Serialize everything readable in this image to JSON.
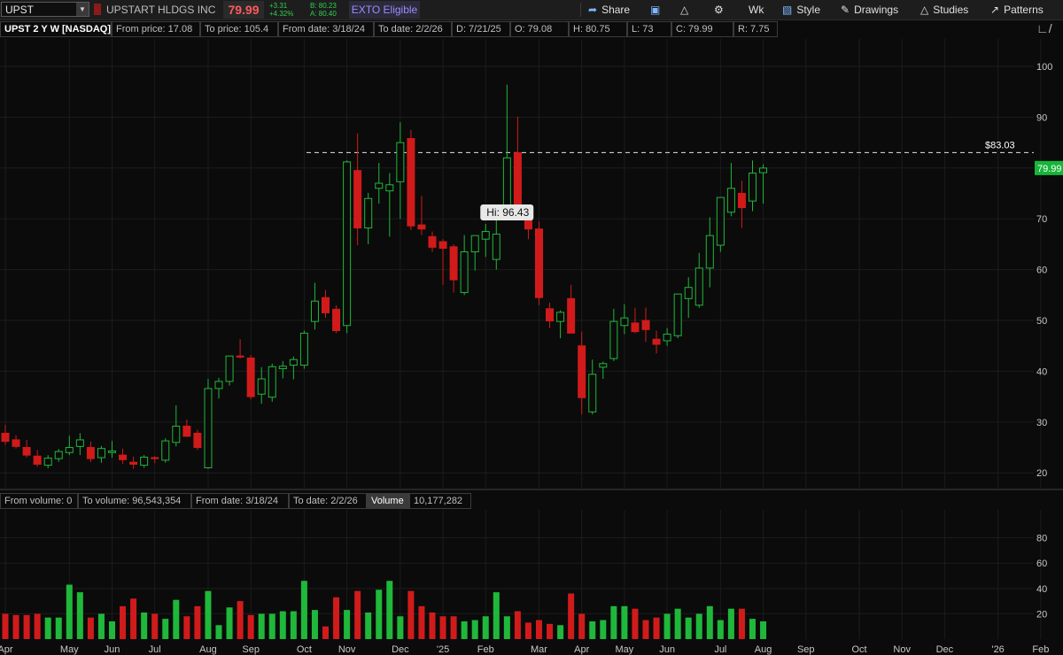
{
  "header": {
    "symbol": "UPST",
    "company": "UPSTART HLDGS INC",
    "last_price": "79.99",
    "net_change": "+3.31",
    "pct_change": "+4.32%",
    "bid": "B: 80.23",
    "ask": "A: 80.40",
    "exto": "EXTO Eligible",
    "toolbar": {
      "share": "Share",
      "aggregation": "Wk",
      "style": "Style",
      "drawings": "Drawings",
      "studies": "Studies",
      "patterns": "Patterns"
    }
  },
  "info_bar": [
    {
      "label": "UPST 2 Y W [NASDAQ]"
    },
    {
      "label": "From price: 17.08"
    },
    {
      "label": "To price: 105.4"
    },
    {
      "label": "From date: 3/18/24"
    },
    {
      "label": "To date: 2/2/26"
    },
    {
      "label": "D: 7/21/25"
    },
    {
      "label": "O: 79.08"
    },
    {
      "label": "H: 80.75"
    },
    {
      "label": "L: 73"
    },
    {
      "label": "C: 79.99"
    },
    {
      "label": "R: 7.75"
    }
  ],
  "volume_info_bar": [
    {
      "label": "From volume: 0"
    },
    {
      "label": "To volume: 96,543,354"
    },
    {
      "label": "From date: 3/18/24"
    },
    {
      "label": "To date: 2/2/26"
    },
    {
      "label": "Volume"
    },
    {
      "label": "10,177,282"
    }
  ],
  "colors": {
    "up": "#1fb83a",
    "down": "#d11b1b",
    "grid": "#1c1c1c",
    "axis_text": "#c8c8c8",
    "last_tag": "#17b53a"
  },
  "chart_data": [
    {
      "type": "candlestick",
      "title": "UPST 2 Y W [NASDAQ]",
      "ylim": [
        17.08,
        105.4
      ],
      "y_ticks": [
        20,
        30,
        40,
        50,
        60,
        70,
        80,
        90,
        100
      ],
      "x_ticks": [
        "Apr",
        "May",
        "Jun",
        "Jul",
        "Aug",
        "Sep",
        "Oct",
        "Nov",
        "Dec",
        "'25",
        "Feb",
        "Mar",
        "Apr",
        "May",
        "Jun",
        "Jul",
        "Aug",
        "Sep",
        "Oct",
        "Nov",
        "Dec",
        "'26",
        "Feb"
      ],
      "x_tick_index": [
        0,
        6,
        10,
        14,
        19,
        23,
        28,
        32,
        37,
        41,
        45,
        50,
        54,
        58,
        62,
        67,
        71,
        75,
        80,
        84,
        88,
        93,
        97
      ],
      "reference_line": {
        "value": 83.03,
        "label": "$83.03"
      },
      "high_label": "Hi: 96.43",
      "high_index": 45,
      "last_price_label": "79.99",
      "candles": [
        [
          27.8,
          29.5,
          25.5,
          26.2
        ],
        [
          26.5,
          27.4,
          24.8,
          25.2
        ],
        [
          25.0,
          26.5,
          23.0,
          23.5
        ],
        [
          23.3,
          24.5,
          21.2,
          21.7
        ],
        [
          21.5,
          23.5,
          20.9,
          22.9
        ],
        [
          22.8,
          24.7,
          22.2,
          24.2
        ],
        [
          24.0,
          27.3,
          23.5,
          25.0
        ],
        [
          25.2,
          27.8,
          23.5,
          26.5
        ],
        [
          25.0,
          26.2,
          22.1,
          22.8
        ],
        [
          23.0,
          25.3,
          22.0,
          24.8
        ],
        [
          24.0,
          26.3,
          23.0,
          24.3
        ],
        [
          23.5,
          24.8,
          21.8,
          22.6
        ],
        [
          22.1,
          23.2,
          20.8,
          21.7
        ],
        [
          21.5,
          23.5,
          21.0,
          23.1
        ],
        [
          23.0,
          23.3,
          21.9,
          22.8
        ],
        [
          22.5,
          26.8,
          22.0,
          26.3
        ],
        [
          26.0,
          33.3,
          25.2,
          29.2
        ],
        [
          29.2,
          30.5,
          27.8,
          27.2
        ],
        [
          27.8,
          28.5,
          24.5,
          25.0
        ],
        [
          21.0,
          38.5,
          20.8,
          36.6
        ],
        [
          36.6,
          38.7,
          34.6,
          38.0
        ],
        [
          38.0,
          42.8,
          37.2,
          43.0
        ],
        [
          43.0,
          46.3,
          42.5,
          42.8
        ],
        [
          42.6,
          43.2,
          34.5,
          35.0
        ],
        [
          35.5,
          40.8,
          33.6,
          38.5
        ],
        [
          34.9,
          41.5,
          34.0,
          40.9
        ],
        [
          40.5,
          42.0,
          38.6,
          41.0
        ],
        [
          41.2,
          42.9,
          38.4,
          42.3
        ],
        [
          41.2,
          48.0,
          40.5,
          47.5
        ],
        [
          49.8,
          57.4,
          48.2,
          53.8
        ],
        [
          54.5,
          56.0,
          50.5,
          51.5
        ],
        [
          52.2,
          53.0,
          47.5,
          48.0
        ],
        [
          49.0,
          81.5,
          47.5,
          81.2
        ],
        [
          79.5,
          86.8,
          64.8,
          68.2
        ],
        [
          68.2,
          75.1,
          65.0,
          74.0
        ],
        [
          76.0,
          81.0,
          73.0,
          77.0
        ],
        [
          75.5,
          79.0,
          66.5,
          76.7
        ],
        [
          77.3,
          89.0,
          70.0,
          85.0
        ],
        [
          85.8,
          87.5,
          67.8,
          68.6
        ],
        [
          68.8,
          74.5,
          66.8,
          68.0
        ],
        [
          66.5,
          67.5,
          63.5,
          64.4
        ],
        [
          65.5,
          66.0,
          57.0,
          64.2
        ],
        [
          64.5,
          65.0,
          55.5,
          58.0
        ],
        [
          55.5,
          66.8,
          55.0,
          63.5
        ],
        [
          63.5,
          66.5,
          59.8,
          66.7
        ],
        [
          66.0,
          69.0,
          62.5,
          67.5
        ],
        [
          62.0,
          71.0,
          60.0,
          67.0
        ],
        [
          71.0,
          96.4,
          70.5,
          82.0
        ],
        [
          83.0,
          90.1,
          70.0,
          71.5
        ],
        [
          71.2,
          72.6,
          66.0,
          68.0
        ],
        [
          68.0,
          69.5,
          53.0,
          54.5
        ],
        [
          52.3,
          53.5,
          48.5,
          49.9
        ],
        [
          49.8,
          52.0,
          46.5,
          51.6
        ],
        [
          54.3,
          57.0,
          47.5,
          47.5
        ],
        [
          45.0,
          47.8,
          31.5,
          34.8
        ],
        [
          32.0,
          42.3,
          31.5,
          39.4
        ],
        [
          40.8,
          41.9,
          38.5,
          41.5
        ],
        [
          42.5,
          52.3,
          42.0,
          49.8
        ],
        [
          49.0,
          53.2,
          47.3,
          50.5
        ],
        [
          49.5,
          52.5,
          47.5,
          47.8
        ],
        [
          50.0,
          52.5,
          45.8,
          48.2
        ],
        [
          46.3,
          48.0,
          43.5,
          45.3
        ],
        [
          46.0,
          48.5,
          45.0,
          47.3
        ],
        [
          47.0,
          53.5,
          46.5,
          55.2
        ],
        [
          54.3,
          58.5,
          50.5,
          56.5
        ],
        [
          53.0,
          63.3,
          52.5,
          60.3
        ],
        [
          60.3,
          70.3,
          56.5,
          66.7
        ],
        [
          64.8,
          71.0,
          63.5,
          74.2
        ],
        [
          71.3,
          81.0,
          70.5,
          76.0
        ],
        [
          75.0,
          77.5,
          68.2,
          72.2
        ],
        [
          73.5,
          81.5,
          71.5,
          79.0
        ],
        [
          79.08,
          80.75,
          73.0,
          79.99
        ]
      ]
    },
    {
      "type": "bar",
      "title": "Volume",
      "ylim": [
        0,
        96.54
      ],
      "y_ticks": [
        20,
        40,
        60,
        80
      ],
      "values": [
        20,
        19,
        19,
        20,
        17,
        17,
        43,
        37,
        17,
        20,
        14,
        26,
        32,
        21,
        20,
        16,
        31,
        18,
        26,
        38,
        11,
        25,
        30,
        19,
        20,
        20,
        22,
        22,
        46,
        23,
        10,
        33,
        23,
        38,
        21,
        39,
        46,
        18,
        38,
        26,
        21,
        18,
        18,
        14,
        15,
        18,
        37,
        18,
        22,
        13,
        15,
        12,
        11,
        36,
        20,
        14,
        15,
        26,
        26,
        24,
        15,
        17,
        20,
        24,
        17,
        20,
        26,
        15,
        24,
        24,
        16,
        14
      ]
    }
  ]
}
